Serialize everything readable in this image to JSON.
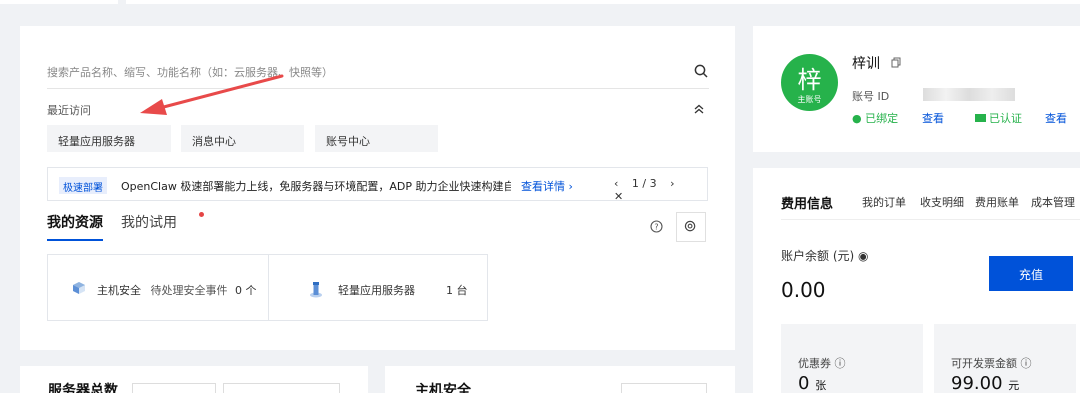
{
  "search": {
    "placeholder": "搜索产品名称、缩写、功能名称（如：云服务器、快照等）"
  },
  "recent": {
    "title": "最近访问",
    "items": [
      "轻量应用服务器",
      "消息中心",
      "账号中心"
    ]
  },
  "banner": {
    "tag": "极速部署",
    "text": "OpenClaw 极速部署能力上线，免服务器与环境配置，ADP 助力企业快速构建自...",
    "link": "查看详情 ›",
    "page": "1 / 3"
  },
  "tabs": {
    "active": "我的资源",
    "other": "我的试用"
  },
  "resources": [
    {
      "name": "主机安全",
      "detail": "待处理安全事件",
      "count": "0 个"
    },
    {
      "name": "轻量应用服务器",
      "detail": "",
      "count": "1 台"
    }
  ],
  "profile": {
    "avatar_char": "梓",
    "avatar_sub": "主账号",
    "name": "梓训",
    "id_label": "账号 ID",
    "wechat_status": "已绑定",
    "wechat_link": "查看",
    "verify_status": "已认证",
    "verify_link": "查看"
  },
  "fees": {
    "title": "费用信息",
    "links": [
      "我的订单",
      "收支明细",
      "费用账单",
      "成本管理"
    ],
    "balance_label": "账户余额 (元)",
    "balance": "0.00",
    "recharge": "充值",
    "coupon_label": "优惠券",
    "coupon_value": "0",
    "coupon_unit": "张",
    "invoice_label": "可开发票金额",
    "invoice_value": "99.00",
    "invoice_unit": "元"
  },
  "bottom": {
    "left_title": "服务器总数",
    "mid_title": "主机安全"
  },
  "colors": {
    "primary": "#0052d9",
    "avatar": "#26b24b",
    "arrow": "#e84a4a"
  }
}
